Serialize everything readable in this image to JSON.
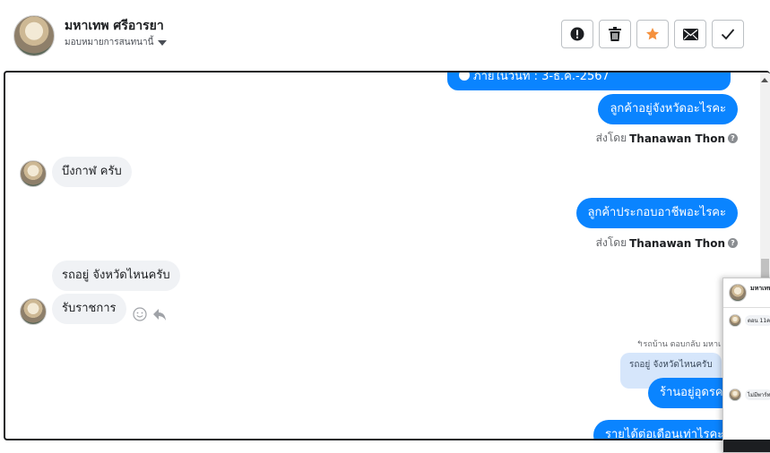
{
  "header": {
    "name": "มหาเทพ ศรีอารยา",
    "assign_label": "มอบหมายการสนทนานี้"
  },
  "actions": [
    {
      "name": "spam",
      "icon": "alert-icon"
    },
    {
      "name": "delete",
      "icon": "trash-icon"
    },
    {
      "name": "star",
      "icon": "star-icon",
      "color": "#f5913e"
    },
    {
      "name": "mark-unread",
      "icon": "envelope-icon"
    },
    {
      "name": "mark-done",
      "icon": "check-icon"
    }
  ],
  "messages": {
    "m0": "ภายในวันที่ : 3-ธ.ค.-2567",
    "m1": "ลูกค้าอยู่จังหวัดอะไรคะ",
    "m2": "บึงกาฬ ครับ",
    "m3": "ลูกค้าประกอบอาชีพอะไรคะ",
    "m4": "รถอยู่ จังหวัดไหนครับ",
    "m5": "รับราชการ",
    "m6": "ร้านอยู่อุดรคะ",
    "m7": "รายได้ต่อเดือนเท่าไรคะ"
  },
  "sent_by": {
    "prefix": "ส่งโดย",
    "agent": "Thanawan Thon"
  },
  "reply_note": "↰รถบ้าน ตอบกลับ มหาเ",
  "quoted_text": "รถอยู่ จังหวัดไหนครับ",
  "mini_chat": {
    "name": "มหาเทพ",
    "line1": "ตอน 11ค",
    "line2": "ไม่มีพาร์ท"
  },
  "colors": {
    "outgoing": "#0a84ff",
    "incoming": "#f0f2f5"
  }
}
